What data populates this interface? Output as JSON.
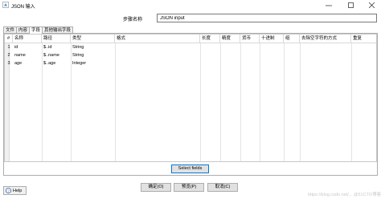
{
  "window": {
    "title": "JSON 输入"
  },
  "step": {
    "label": "步骤名称",
    "value": "JSON input"
  },
  "tabs": [
    {
      "label": "文件",
      "active": false
    },
    {
      "label": "内容",
      "active": false
    },
    {
      "label": "字段",
      "active": true
    },
    {
      "label": "其他输出字段",
      "active": false
    }
  ],
  "grid": {
    "headers": [
      "#",
      "名称",
      "路径",
      "类型",
      "格式",
      "长度",
      "精度",
      "货币",
      "十进制",
      "组",
      "去除空字符的方式",
      "重复"
    ],
    "rows": [
      [
        "1",
        "id",
        "$..id",
        "String",
        "",
        "",
        "",
        "",
        "",
        "",
        "",
        ""
      ],
      [
        "2",
        "name",
        "$..name",
        "String",
        "",
        "",
        "",
        "",
        "",
        "",
        "",
        ""
      ],
      [
        "3",
        "age",
        "$..age",
        "Integer",
        "",
        "",
        "",
        "",
        "",
        "",
        "",
        ""
      ]
    ]
  },
  "buttons": {
    "select_fields": "Select fields",
    "help": "Help",
    "ok": "确定(O)",
    "preview": "预览(P)",
    "cancel": "取消(C)"
  },
  "watermark": "https://blog.csdn.net/... @51CTO博客",
  "colors": {
    "accent": "#0078d7",
    "panel_border": "#adadad",
    "grid_bg": "#f0f0f0"
  }
}
